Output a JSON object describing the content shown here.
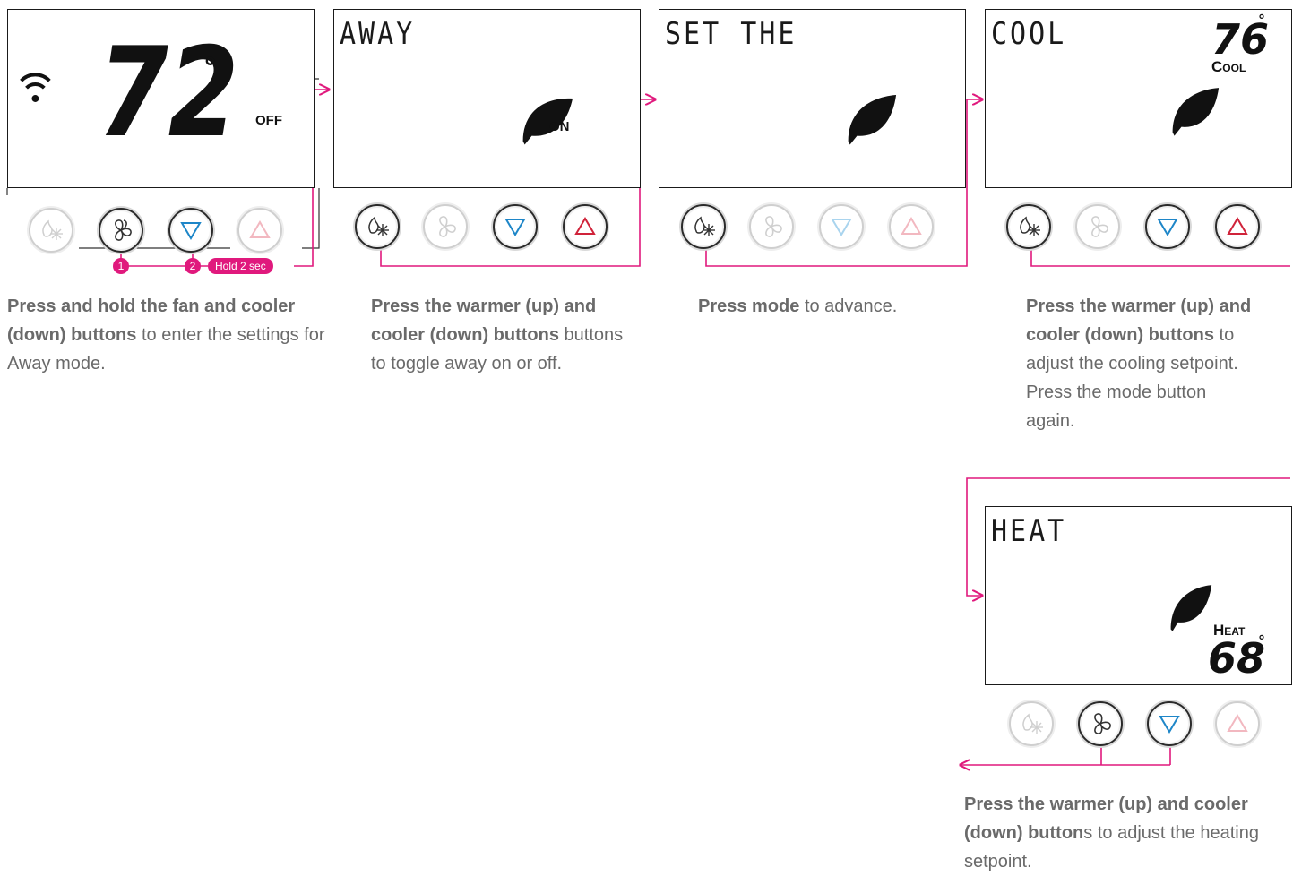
{
  "screens": [
    {
      "id": "home",
      "digits": "72",
      "status": "OFF"
    },
    {
      "id": "away",
      "lcd": "AWAY",
      "fan_status": "ON"
    },
    {
      "id": "set",
      "lcd": "SET THE"
    },
    {
      "id": "cool",
      "lcd": "COOL",
      "setpoint": "76",
      "mode_label": "Cool"
    },
    {
      "id": "heat",
      "lcd": "HEAT",
      "setpoint": "68",
      "mode_label": "Heat"
    }
  ],
  "buttons": [
    "mode",
    "fan",
    "down",
    "up"
  ],
  "callouts": {
    "step1": "1",
    "step2": "2",
    "hold": "Hold 2 sec"
  },
  "captions": {
    "c1": {
      "bold": "Press and hold the fan and cooler (down) buttons",
      "rest": " to enter the settings for Away mode."
    },
    "c2": {
      "bold": "Press the warmer (up) and cooler (down) buttons",
      "rest": " buttons to toggle away on or off."
    },
    "c3": {
      "bold": "Press mode",
      "rest": " to advance."
    },
    "c4": {
      "bold": "Press the warmer (up) and cooler (down) buttons",
      "rest": " to adjust the cooling setpoint.  Press the mode button again."
    },
    "c5": {
      "bold": "Press the warmer (up) and cooler (down) button",
      "rest": "s to adjust the heating setpoint."
    }
  },
  "colors": {
    "accent": "#e0197d",
    "down_arrow": "#1e86c8",
    "up_arrow": "#d0233a",
    "text": "#6a6a6a"
  }
}
